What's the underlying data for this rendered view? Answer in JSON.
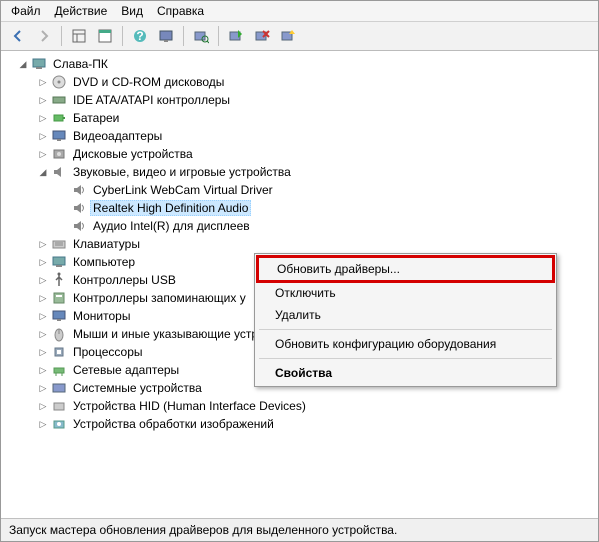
{
  "menu": {
    "file": "Файл",
    "action": "Действие",
    "view": "Вид",
    "help": "Справка"
  },
  "toolbar_icons": [
    "back",
    "forward",
    "|",
    "table",
    "app",
    "|",
    "help",
    "monitor",
    "|",
    "scan",
    "|",
    "window",
    "uninstall",
    "update"
  ],
  "tree": {
    "root": "Слава-ПК",
    "items": [
      {
        "label": "DVD и CD-ROM дисководы",
        "icon": "disc"
      },
      {
        "label": "IDE ATA/ATAPI контроллеры",
        "icon": "ide"
      },
      {
        "label": "Батареи",
        "icon": "battery"
      },
      {
        "label": "Видеоадаптеры",
        "icon": "display"
      },
      {
        "label": "Дисковые устройства",
        "icon": "disk"
      },
      {
        "label": "Звуковые, видео и игровые устройства",
        "icon": "sound",
        "expanded": true,
        "children": [
          {
            "label": "CyberLink WebCam Virtual Driver",
            "icon": "speaker"
          },
          {
            "label": "Realtek High Definition Audio",
            "icon": "speaker",
            "selected": true
          },
          {
            "label": "Аудио Intel(R) для дисплеев",
            "icon": "speaker"
          }
        ]
      },
      {
        "label": "Клавиатуры",
        "icon": "keyboard"
      },
      {
        "label": "Компьютер",
        "icon": "computer"
      },
      {
        "label": "Контроллеры USB",
        "icon": "usb"
      },
      {
        "label": "Контроллеры запоминающих у",
        "icon": "storage"
      },
      {
        "label": "Мониторы",
        "icon": "monitor"
      },
      {
        "label": "Мыши и иные указывающие устройства",
        "icon": "mouse",
        "truncated": true
      },
      {
        "label": "Процессоры",
        "icon": "cpu"
      },
      {
        "label": "Сетевые адаптеры",
        "icon": "network"
      },
      {
        "label": "Системные устройства",
        "icon": "system"
      },
      {
        "label": "Устройства HID (Human Interface Devices)",
        "icon": "hid"
      },
      {
        "label": "Устройства обработки изображений",
        "icon": "imaging"
      }
    ]
  },
  "context_menu": {
    "update": "Обновить драйверы...",
    "disable": "Отключить",
    "delete": "Удалить",
    "refresh": "Обновить конфигурацию оборудования",
    "properties": "Свойства"
  },
  "statusbar": "Запуск мастера обновления драйверов для выделенного устройства."
}
